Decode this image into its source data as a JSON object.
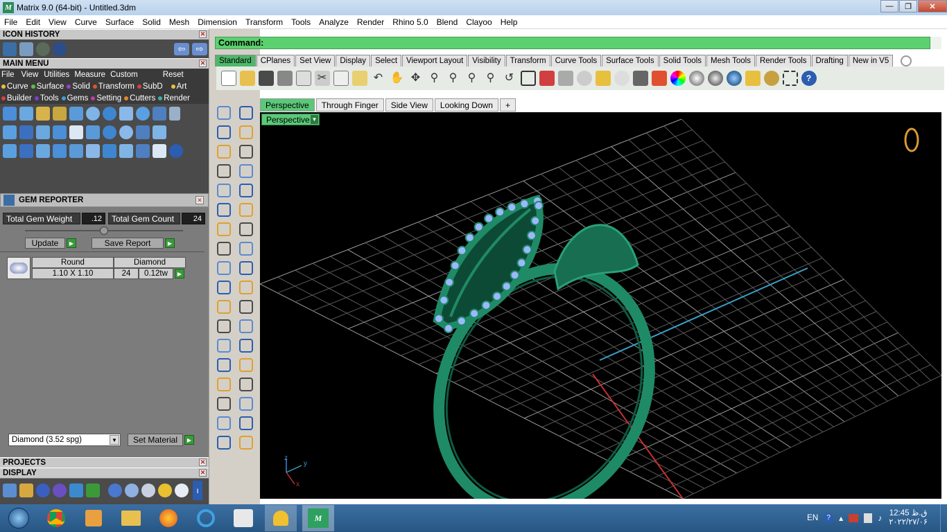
{
  "window": {
    "title": "Matrix 9.0 (64-bit) - Untitled.3dm",
    "minimize": "—",
    "maximize": "❐",
    "close": "✕"
  },
  "menubar": [
    "File",
    "Edit",
    "View",
    "Curve",
    "Surface",
    "Solid",
    "Mesh",
    "Dimension",
    "Transform",
    "Tools",
    "Analyze",
    "Render",
    "Rhino 5.0",
    "Blend",
    "Clayoo",
    "Help"
  ],
  "left_panel": {
    "icon_history_title": "ICON HISTORY",
    "main_menu_title": "MAIN MENU",
    "main_menu_row1": [
      "File",
      "View",
      "Utilities",
      "Measure",
      "Custom"
    ],
    "reset_label": "Reset",
    "main_menu_row2": [
      "Curve",
      "Surface",
      "Solid",
      "Transform",
      "SubD",
      "Art"
    ],
    "main_menu_row3": [
      "Builder",
      "Tools",
      "Gems",
      "Setting",
      "Cutters",
      "Render"
    ],
    "gem_reporter_title": "GEM REPORTER",
    "total_gem_weight_label": "Total Gem Weight",
    "total_gem_weight_value": ".12",
    "total_gem_count_label": "Total Gem Count",
    "total_gem_count_value": "24",
    "update_label": "Update",
    "save_report_label": "Save Report",
    "gem_table": {
      "cut": "Round",
      "type": "Diamond",
      "size": "1.10 X 1.10",
      "count": "24",
      "weight": "0.12tw"
    },
    "material_select": "Diamond    (3.52 spg)",
    "set_material_label": "Set Material",
    "projects_title": "PROJECTS",
    "display_title": "DISPLAY"
  },
  "command": {
    "prompt": "Command:"
  },
  "toolbar_tabs": [
    "Standard",
    "CPlanes",
    "Set View",
    "Display",
    "Select",
    "Viewport Layout",
    "Visibility",
    "Transform",
    "Curve Tools",
    "Surface Tools",
    "Solid Tools",
    "Mesh Tools",
    "Render Tools",
    "Drafting",
    "New in V5"
  ],
  "viewport_tabs": [
    "Perspective",
    "Through Finger",
    "Side View",
    "Looking Down",
    "+"
  ],
  "viewport": {
    "label": "Perspective",
    "axis_z": "z",
    "axis_y": "y",
    "axis_x": "x"
  },
  "taskbar": {
    "lang": "EN",
    "time": "12:45 ق.ظ",
    "date": "۲۰۲۲/۲۷/۰۶"
  },
  "colors": {
    "accent_green": "#4db86a",
    "ring_green": "#1f8a66",
    "gem_blue": "#9bb8ff",
    "command_bar": "#5bd16f"
  }
}
